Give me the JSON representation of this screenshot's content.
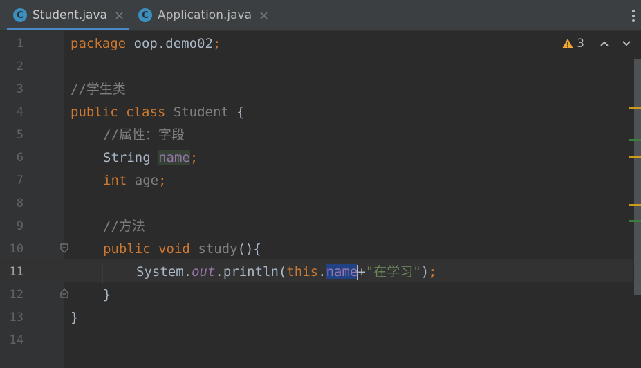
{
  "tabs": [
    {
      "label": "Student.java",
      "icon": "C",
      "active": true
    },
    {
      "label": "Application.java",
      "icon": "C",
      "active": false
    }
  ],
  "inspections": {
    "warning_count": "3"
  },
  "line_numbers": [
    "1",
    "2",
    "3",
    "4",
    "5",
    "6",
    "7",
    "8",
    "9",
    "10",
    "11",
    "12",
    "13",
    "14"
  ],
  "code": {
    "l1_kw": "package",
    "l1_rest": " oop.demo02",
    "l1_semi": ";",
    "l3": "//学生类",
    "l4_kw1": "public",
    "l4_kw2": "class",
    "l4_name": "Student",
    "l4_brace": " {",
    "l5": "//属性：字段",
    "l6_type": "String ",
    "l6_field": "name",
    "l6_semi": ";",
    "l7_kw": "int",
    "l7_field": " age",
    "l7_semi": ";",
    "l9": "//方法",
    "l10_kw1": "public",
    "l10_kw2": "void",
    "l10_name": "study",
    "l10_rest": "(){",
    "l11_sys": "System.",
    "l11_out": "out",
    "l11_print": ".println(",
    "l11_this": "this",
    "l11_dot": ".",
    "l11_name": "name",
    "l11_plus": "+",
    "l11_str": "\"在学习\"",
    "l11_end": ")",
    "l11_semi": ";",
    "l12": "}",
    "l13": "}"
  },
  "colors": {
    "accent": "#4a88c7",
    "keyword": "#cc7832",
    "comment": "#808080",
    "field": "#9876aa",
    "string": "#6a8759",
    "warning": "#f0a732"
  }
}
